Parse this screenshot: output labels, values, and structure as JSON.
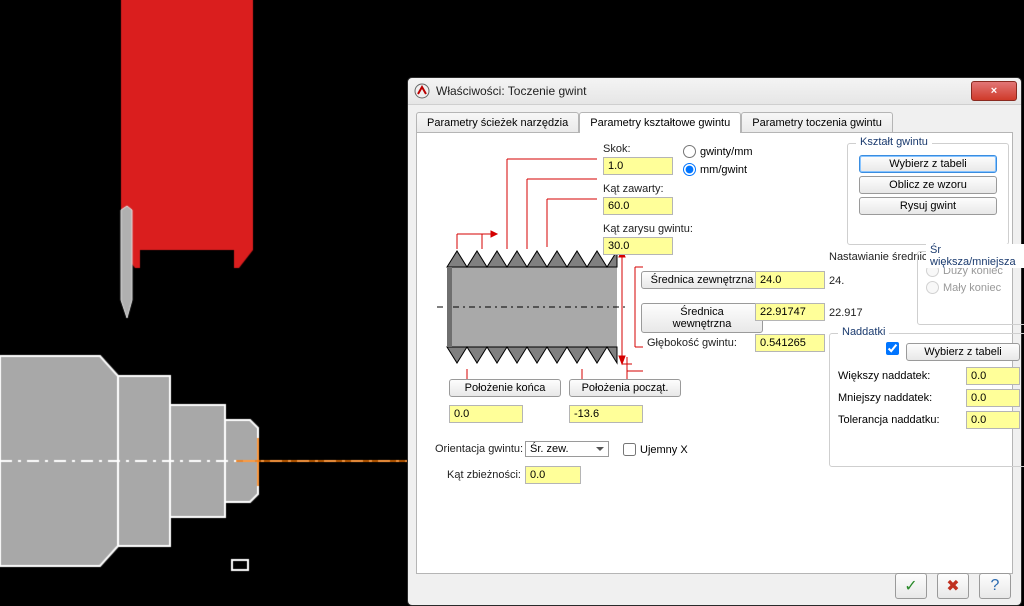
{
  "window": {
    "title": "Właściwości: Toczenie gwint",
    "close_icon": "×"
  },
  "tabs": {
    "t1": "Parametry ścieżek narzędzia",
    "t2": "Parametry kształtowe gwintu",
    "t3": "Parametry toczenia gwintu"
  },
  "labels": {
    "pitch": "Skok:",
    "units_tpi": "gwinty/mm",
    "units_mm": "mm/gwint",
    "included_angle": "Kąt zawarty:",
    "profile_angle": "Kąt zarysu gwintu:",
    "outer_dia_btn": "Średnica zewnętrzna",
    "inner_dia_btn": "Średnica wewnętrzna",
    "thread_depth": "Głębokość gwintu:",
    "end_pos_btn": "Położenie końca",
    "start_pos_btn": "Położenia począt.",
    "orientation": "Orientacja gwintu:",
    "orientation_value": "Śr. zew.",
    "neg_x": "Ujemny X",
    "taper_angle": "Kąt zbieżności:"
  },
  "values": {
    "pitch": "1.0",
    "included_angle": "60.0",
    "profile_angle": "30.0",
    "outer_dia": "24.0",
    "inner_dia": "22.91747",
    "thread_depth": "0.541265",
    "end_pos": "0.0",
    "start_pos": "-13.6",
    "taper_angle": "0.0"
  },
  "shape_group": {
    "legend": "Kształt gwintu",
    "select_table": "Wybierz z tabeli",
    "compute": "Oblicz ze wzoru",
    "draw": "Rysuj gwint"
  },
  "dia_setting": {
    "label": "Nastawianie średnicy",
    "value": "24.",
    "value2": "22.917"
  },
  "big_small_group": {
    "legend": "Śr większa/mniejsza",
    "big": "Duży koniec",
    "small": "Mały koniec"
  },
  "allowances": {
    "legend": "Naddatki",
    "select_table": "Wybierz z tabeli",
    "major": "Większy naddatek:",
    "minor": "Mniejszy naddatek:",
    "tol": "Tolerancja naddatku:",
    "major_v": "0.0",
    "minor_v": "0.0",
    "tol_v": "0.0"
  },
  "footer": {
    "ok": "✓",
    "cancel": "✖",
    "help": "?"
  }
}
